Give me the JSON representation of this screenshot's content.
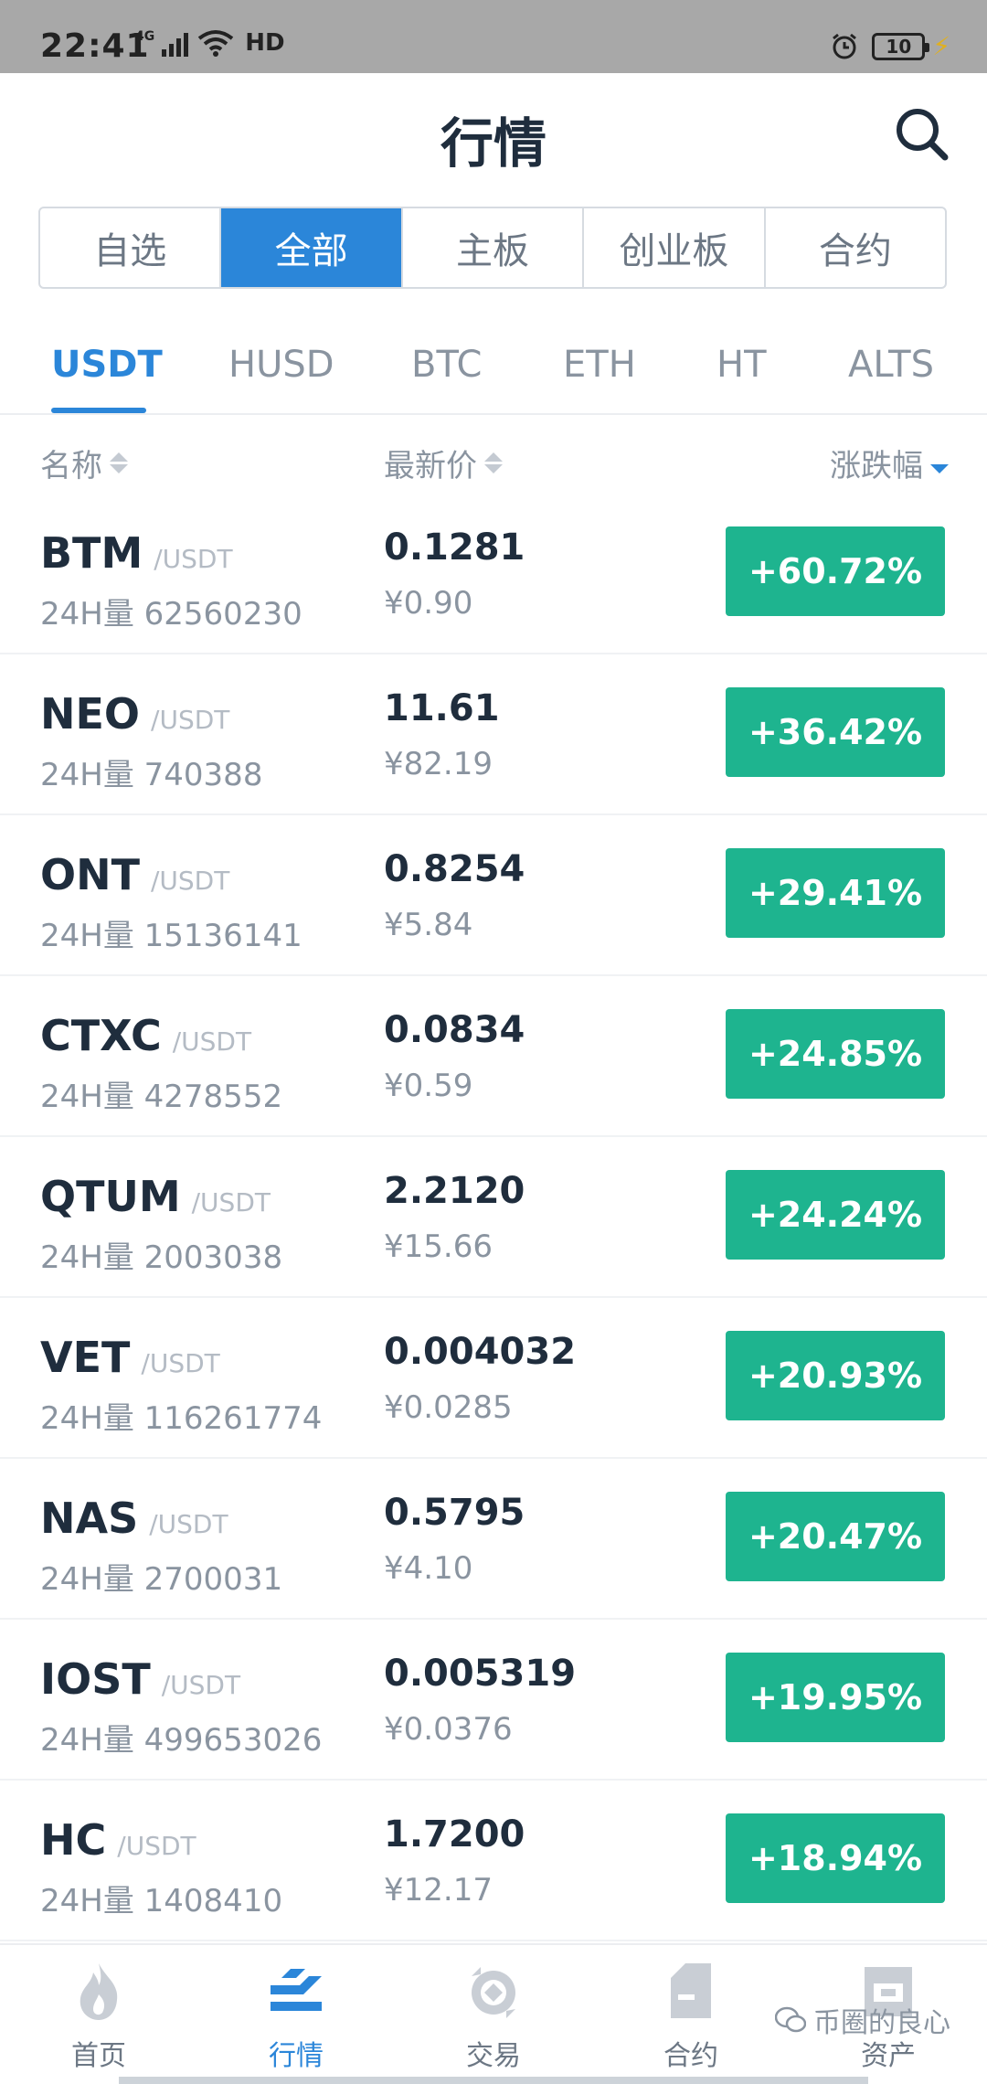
{
  "status_bar": {
    "time": "22:41",
    "network": "4G",
    "hd": "HD",
    "battery": "10"
  },
  "header": {
    "title": "行情"
  },
  "segment_tabs": [
    {
      "label": "自选",
      "active": false
    },
    {
      "label": "全部",
      "active": true
    },
    {
      "label": "主板",
      "active": false
    },
    {
      "label": "创业板",
      "active": false
    },
    {
      "label": "合约",
      "active": false
    }
  ],
  "quote_tabs": [
    {
      "label": "USDT",
      "active": true
    },
    {
      "label": "HUSD",
      "active": false
    },
    {
      "label": "BTC",
      "active": false
    },
    {
      "label": "ETH",
      "active": false
    },
    {
      "label": "HT",
      "active": false
    },
    {
      "label": "ALTS",
      "active": false
    }
  ],
  "columns": {
    "name": "名称",
    "price": "最新价",
    "change": "涨跌幅"
  },
  "vol_label": "24H量",
  "rows": [
    {
      "symbol": "BTM",
      "pair": "/USDT",
      "volume": "62560230",
      "price": "0.1281",
      "cny": "¥0.90",
      "change": "+60.72%"
    },
    {
      "symbol": "NEO",
      "pair": "/USDT",
      "volume": "740388",
      "price": "11.61",
      "cny": "¥82.19",
      "change": "+36.42%"
    },
    {
      "symbol": "ONT",
      "pair": "/USDT",
      "volume": "15136141",
      "price": "0.8254",
      "cny": "¥5.84",
      "change": "+29.41%"
    },
    {
      "symbol": "CTXC",
      "pair": "/USDT",
      "volume": "4278552",
      "price": "0.0834",
      "cny": "¥0.59",
      "change": "+24.85%"
    },
    {
      "symbol": "QTUM",
      "pair": "/USDT",
      "volume": "2003038",
      "price": "2.2120",
      "cny": "¥15.66",
      "change": "+24.24%"
    },
    {
      "symbol": "VET",
      "pair": "/USDT",
      "volume": "116261774",
      "price": "0.004032",
      "cny": "¥0.0285",
      "change": "+20.93%"
    },
    {
      "symbol": "NAS",
      "pair": "/USDT",
      "volume": "2700031",
      "price": "0.5795",
      "cny": "¥4.10",
      "change": "+20.47%"
    },
    {
      "symbol": "IOST",
      "pair": "/USDT",
      "volume": "499653026",
      "price": "0.005319",
      "cny": "¥0.0376",
      "change": "+19.95%"
    },
    {
      "symbol": "HC",
      "pair": "/USDT",
      "volume": "1408410",
      "price": "1.7200",
      "cny": "¥12.17",
      "change": "+18.94%"
    }
  ],
  "bottom_nav": [
    {
      "label": "首页",
      "icon": "flame-icon",
      "active": false
    },
    {
      "label": "行情",
      "icon": "market-chart-icon",
      "active": true
    },
    {
      "label": "交易",
      "icon": "exchange-coin-icon",
      "active": false
    },
    {
      "label": "合约",
      "icon": "contract-doc-icon",
      "active": false
    },
    {
      "label": "资产",
      "icon": "wallet-icon",
      "active": false
    }
  ],
  "watermark": "币圈的良心",
  "colors": {
    "accent": "#2b86d9",
    "up": "#1eb48f",
    "text": "#1f2d3d",
    "muted": "#8a94a0"
  }
}
